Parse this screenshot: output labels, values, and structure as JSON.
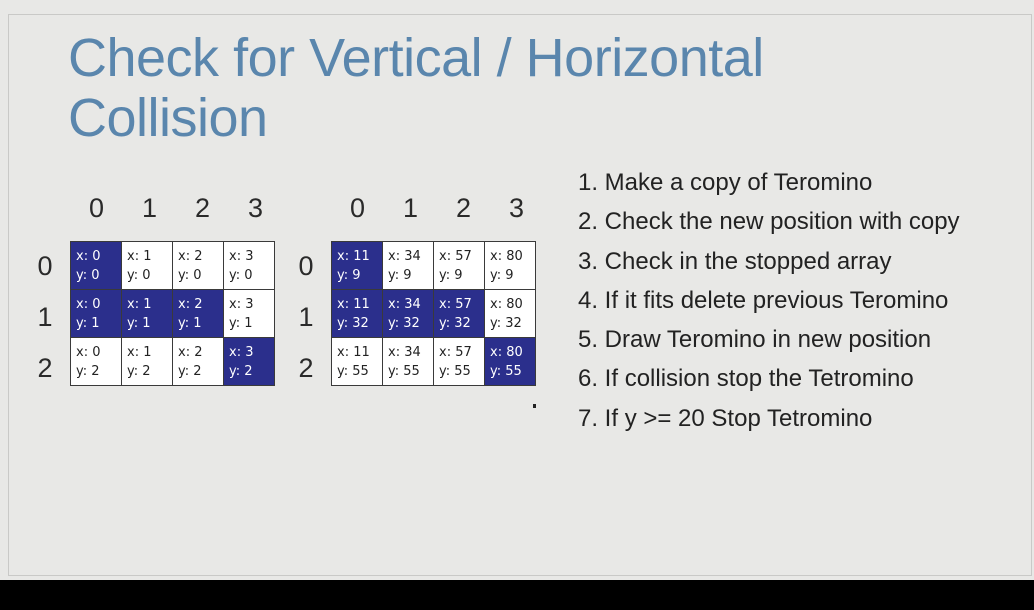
{
  "title": {
    "line1": "Check for Vertical / Horizontal",
    "line2": "Collision"
  },
  "grid_left": {
    "col_headers": [
      "0",
      "1",
      "2",
      "3"
    ],
    "row_headers": [
      "0",
      "1",
      "2"
    ],
    "rows": [
      [
        {
          "x": "x: 0",
          "y": "y: 0",
          "filled": true
        },
        {
          "x": "x: 1",
          "y": "y: 0",
          "filled": false
        },
        {
          "x": "x: 2",
          "y": "y: 0",
          "filled": false
        },
        {
          "x": "x: 3",
          "y": "y: 0",
          "filled": false
        }
      ],
      [
        {
          "x": "x: 0",
          "y": "y: 1",
          "filled": true
        },
        {
          "x": "x: 1",
          "y": "y: 1",
          "filled": true
        },
        {
          "x": "x: 2",
          "y": "y: 1",
          "filled": true
        },
        {
          "x": "x: 3",
          "y": "y: 1",
          "filled": false
        }
      ],
      [
        {
          "x": "x: 0",
          "y": "y: 2",
          "filled": false
        },
        {
          "x": "x: 1",
          "y": "y: 2",
          "filled": false
        },
        {
          "x": "x: 2",
          "y": "y: 2",
          "filled": false
        },
        {
          "x": "x: 3",
          "y": "y: 2",
          "filled": true
        }
      ]
    ]
  },
  "grid_right": {
    "col_headers": [
      "0",
      "1",
      "2",
      "3"
    ],
    "row_headers": [
      "0",
      "1",
      "2"
    ],
    "rows": [
      [
        {
          "x": "x: 11",
          "y": "y: 9",
          "filled": true
        },
        {
          "x": "x: 34",
          "y": "y: 9",
          "filled": false
        },
        {
          "x": "x: 57",
          "y": "y: 9",
          "filled": false
        },
        {
          "x": "x: 80",
          "y": "y: 9",
          "filled": false
        }
      ],
      [
        {
          "x": "x: 11",
          "y": "y: 32",
          "filled": true
        },
        {
          "x": "x: 34",
          "y": "y: 32",
          "filled": true
        },
        {
          "x": "x: 57",
          "y": "y: 32",
          "filled": true
        },
        {
          "x": "x: 80",
          "y": "y: 32",
          "filled": false
        }
      ],
      [
        {
          "x": "x: 11",
          "y": "y: 55",
          "filled": false
        },
        {
          "x": "x: 34",
          "y": "y: 55",
          "filled": false
        },
        {
          "x": "x: 57",
          "y": "y: 55",
          "filled": false
        },
        {
          "x": "x: 80",
          "y": "y: 55",
          "filled": true
        }
      ]
    ]
  },
  "steps": [
    "1. Make a copy of Teromino",
    "2. Check the new position with copy",
    "3. Check in the stopped array",
    "4. If it fits delete previous Teromino",
    "5. Draw Teromino in new position",
    "6. If collision stop the Tetromino",
    "7. If y >= 20 Stop Tetromino"
  ],
  "colors": {
    "title": "#5a86ad",
    "filled_cell": "#2b2f8c",
    "slide_background": "#e8e8e6",
    "letterbox": "#000000"
  }
}
